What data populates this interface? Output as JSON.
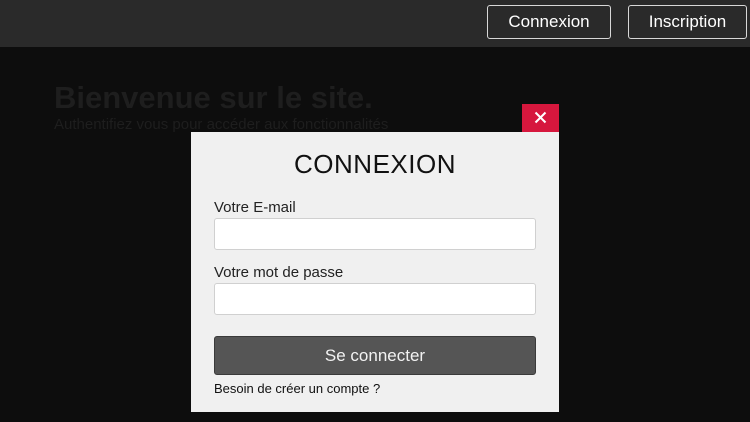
{
  "header": {
    "login_label": "Connexion",
    "signup_label": "Inscription"
  },
  "main": {
    "welcome_title": "Bienvenue sur le site.",
    "welcome_subtitle": "Authentifiez vous pour accéder aux fonctionnalités"
  },
  "modal": {
    "title": "CONNEXION",
    "close_icon": "close-icon",
    "email_label": "Votre E-mail",
    "email_value": "",
    "password_label": "Votre mot de passe",
    "password_value": "",
    "submit_label": "Se connecter",
    "signup_link": "Besoin de créer un compte ?"
  },
  "colors": {
    "close_button": "#d6173d",
    "submit_button": "#555555",
    "topbar": "#2a2a2a"
  }
}
